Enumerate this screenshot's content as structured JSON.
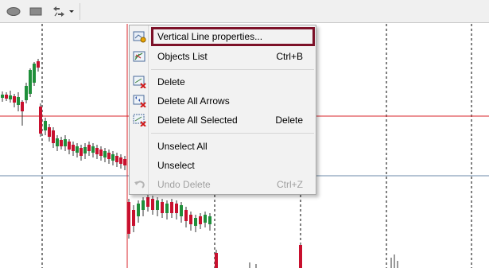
{
  "toolbar": {
    "icons": [
      "ellipse-tool-icon",
      "rectangle-tool-icon",
      "arrows-tool-icon",
      "dropdown-arrow-icon"
    ]
  },
  "colors": {
    "highlight": "#7c1128",
    "red_line": "#d9262b",
    "blue_line": "#6b8aa8",
    "candle_up": "#1f8f3a",
    "candle_down": "#c8102e"
  },
  "context_menu": {
    "items": [
      {
        "label": "Vertical Line properties...",
        "shortcut": "",
        "icon": "properties-icon",
        "enabled": true,
        "highlighted": true
      },
      {
        "label": "Objects List",
        "shortcut": "Ctrl+B",
        "icon": "objects-list-icon",
        "enabled": true
      },
      {
        "label": "Delete",
        "shortcut": "",
        "icon": "delete-icon",
        "enabled": true
      },
      {
        "label": "Delete All Arrows",
        "shortcut": "",
        "icon": "delete-all-arrows-icon",
        "enabled": true
      },
      {
        "label": "Delete All Selected",
        "shortcut": "Delete",
        "icon": "delete-all-selected-icon",
        "enabled": true
      },
      {
        "label": "Unselect All",
        "shortcut": "",
        "icon": "",
        "enabled": true
      },
      {
        "label": "Unselect",
        "shortcut": "",
        "icon": "",
        "enabled": true
      },
      {
        "label": "Undo Delete",
        "shortcut": "Ctrl+Z",
        "icon": "undo-icon",
        "enabled": false
      }
    ]
  }
}
